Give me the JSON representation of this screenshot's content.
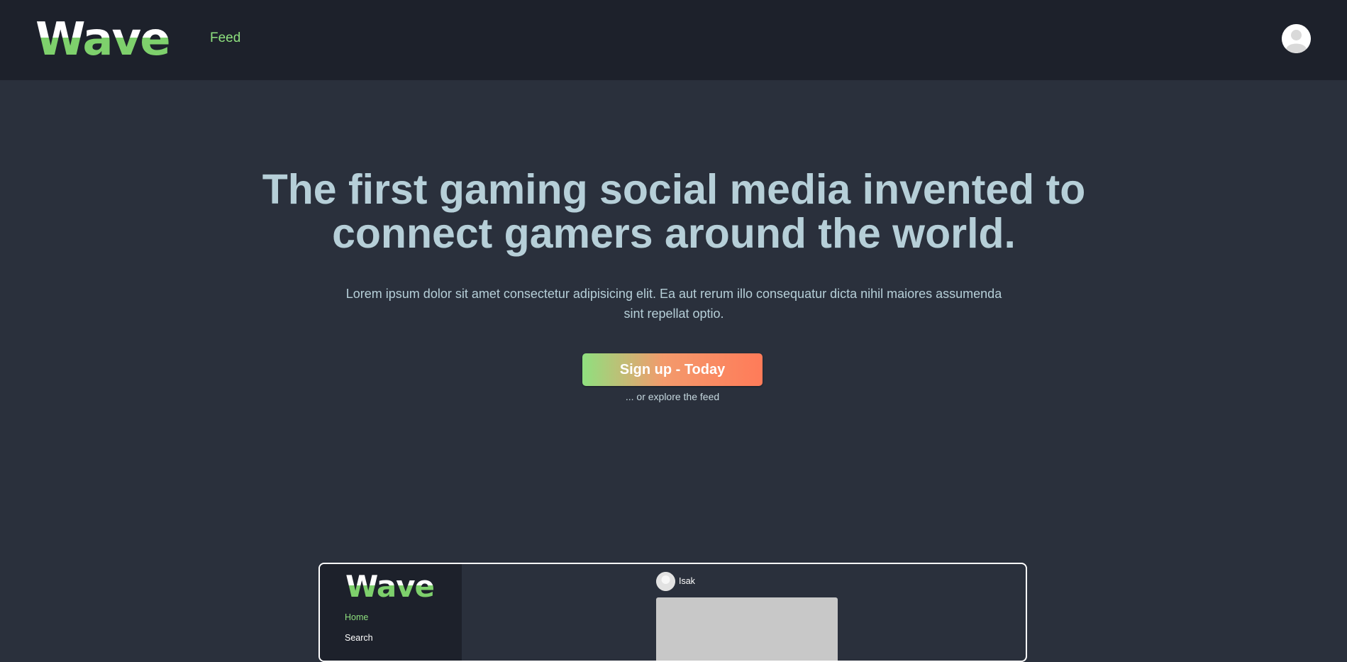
{
  "navbar": {
    "logo_text": "Wave",
    "feed_link": "Feed",
    "profile_icon": "user-avatar-icon"
  },
  "hero": {
    "title": "The first gaming social media invented to connect gamers around the world.",
    "subtitle": "Lorem ipsum dolor sit amet consectetur adipisicing elit. Ea aut rerum illo consequatur dicta nihil maiores assumenda sint repellat optio.",
    "cta_label": "Sign up - Today",
    "explore_text": "... or explore the feed"
  },
  "preview": {
    "logo_text": "Wave",
    "nav": [
      {
        "label": "Home",
        "active": true
      },
      {
        "label": "Search",
        "active": false
      }
    ],
    "post": {
      "username": "Isak",
      "avatar_icon": "user-avatar-icon"
    }
  },
  "colors": {
    "page_bg": "#2a303c",
    "navbar_bg": "#1d212b",
    "accent_green": "#8ee07e",
    "accent_orange": "#ff7b59",
    "hero_text": "#b6cfd8"
  }
}
